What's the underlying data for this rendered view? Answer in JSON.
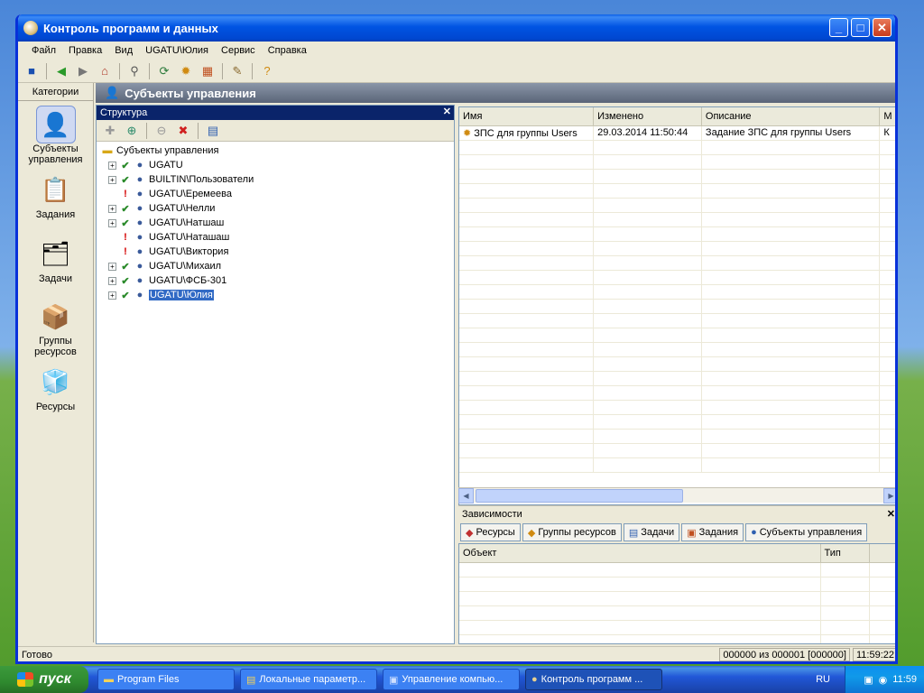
{
  "window": {
    "title": "Контроль программ и данных"
  },
  "menu": [
    "Файл",
    "Правка",
    "Вид",
    "UGATU\\Юлия",
    "Сервис",
    "Справка"
  ],
  "toolbar_icons": [
    "save-icon",
    "back-icon",
    "forward-icon",
    "home-icon",
    "search-icon",
    "refresh-icon",
    "settings-icon",
    "calculator-icon",
    "tools-icon",
    "help-icon"
  ],
  "categories": {
    "header": "Категории",
    "items": [
      {
        "label": "Субъекты управления",
        "icon": "user-icon",
        "selected": true
      },
      {
        "label": "Задания",
        "icon": "clipboard-clock-icon"
      },
      {
        "label": "Задачи",
        "icon": "tasks-icon"
      },
      {
        "label": "Группы ресурсов",
        "icon": "resource-groups-icon"
      },
      {
        "label": "Ресурсы",
        "icon": "resources-icon"
      }
    ]
  },
  "section": {
    "title": "Субъекты управления"
  },
  "structure": {
    "header": "Структура",
    "close": "✕",
    "root": "Субъекты управления",
    "nodes": [
      {
        "label": "UGATU",
        "status": "ok",
        "expand": true
      },
      {
        "label": "BUILTIN\\Пользователи",
        "status": "ok",
        "expand": true
      },
      {
        "label": "UGATU\\Еремеева",
        "status": "warn",
        "expand": false
      },
      {
        "label": "UGATU\\Нелли",
        "status": "ok",
        "expand": true
      },
      {
        "label": "UGATU\\Натшаш",
        "status": "ok",
        "expand": true
      },
      {
        "label": "UGATU\\Наташаш",
        "status": "warn",
        "expand": false
      },
      {
        "label": "UGATU\\Виктория",
        "status": "warn",
        "expand": false
      },
      {
        "label": "UGATU\\Михаил",
        "status": "ok",
        "expand": true
      },
      {
        "label": "UGATU\\ФСБ-301",
        "status": "ok",
        "expand": true
      },
      {
        "label": "UGATU\\Юлия",
        "status": "ok",
        "expand": true,
        "selected": true
      }
    ]
  },
  "grid": {
    "columns": [
      "Имя",
      "Изменено",
      "Описание",
      "М"
    ],
    "rows": [
      {
        "name": "ЗПС для группы Users",
        "changed": "29.03.2014    11:50:44",
        "desc": "Задание ЗПС для группы Users",
        "m": "К"
      }
    ]
  },
  "dependencies": {
    "header": "Зависимости",
    "close": "✕",
    "tabs": [
      "Ресурсы",
      "Группы ресурсов",
      "Задачи",
      "Задания",
      "Субъекты управления"
    ],
    "columns": [
      "Объект",
      "Тип"
    ]
  },
  "status": {
    "text": "Готово",
    "count": "000000 из 000001 [000000]",
    "time": "11:59:22"
  },
  "taskbar": {
    "start": "пуск",
    "items": [
      "Program Files",
      "Локальные параметр...",
      "Управление компью...",
      "Контроль программ ..."
    ],
    "lang": "RU",
    "clock": "11:59"
  }
}
